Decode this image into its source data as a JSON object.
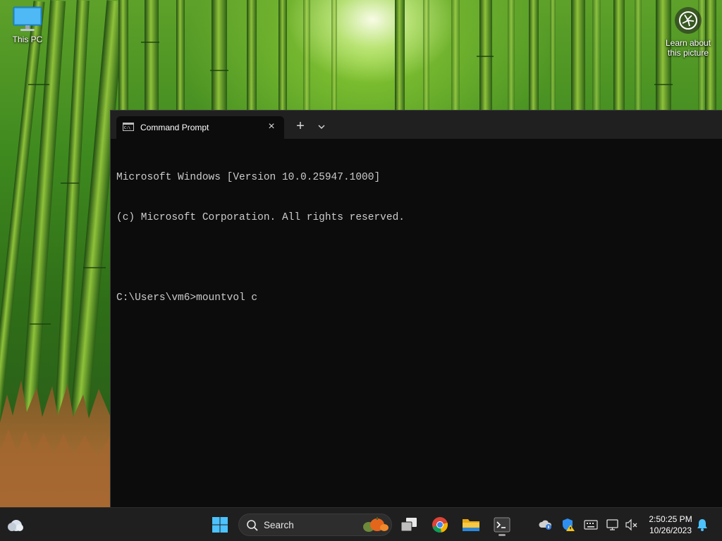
{
  "desktop": {
    "icons": [
      {
        "label": "This PC"
      }
    ],
    "spotlight": {
      "label_line1": "Learn about",
      "label_line2": "this picture"
    }
  },
  "terminal": {
    "tab_title": "Command Prompt",
    "tab_icon": "cmd-icon",
    "close_tab": "×",
    "new_tab": "+",
    "console_lines": [
      "Microsoft Windows [Version 10.0.25947.1000]",
      "(c) Microsoft Corporation. All rights reserved.",
      "",
      "C:\\Users\\vm6>mountvol c"
    ],
    "background_color": "#0c0c0c",
    "text_color": "#cccccc"
  },
  "taskbar": {
    "search_placeholder": "Search",
    "pinned": [
      "weather-icon",
      "start-icon",
      "task-view-icon",
      "chrome-icon",
      "file-explorer-icon",
      "terminal-icon"
    ],
    "tray": [
      "onedrive-icon",
      "security-warning-icon",
      "keyboard-icon",
      "network-icon",
      "volume-muted-icon"
    ],
    "clock": {
      "time": "2:50:25 PM",
      "date": "10/26/2023"
    },
    "accent_color": "#4cc2ff"
  }
}
